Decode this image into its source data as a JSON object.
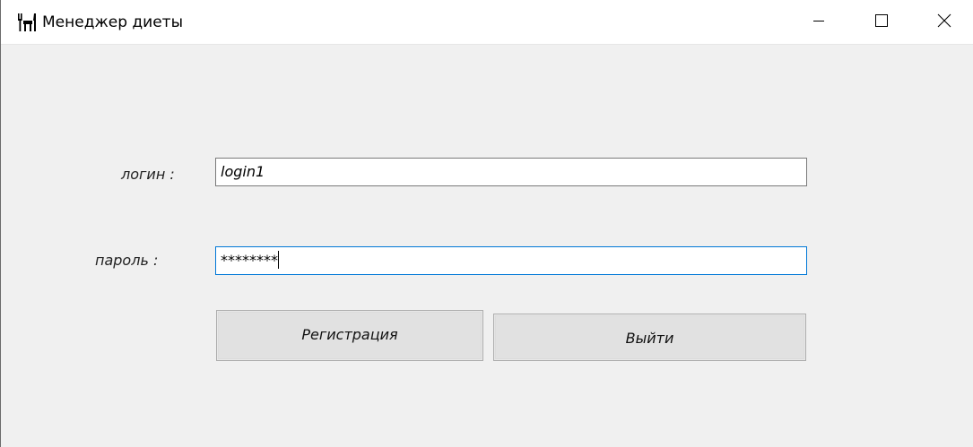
{
  "window": {
    "title": "Менеджер диеты",
    "app_icon": "fork-knife-icon",
    "controls": {
      "minimize_icon": "minimize-icon",
      "maximize_icon": "maximize-icon",
      "close_icon": "close-icon"
    }
  },
  "form": {
    "login_label": "логин :",
    "login_value": "login1",
    "password_label": "пароль :",
    "password_value": "********",
    "register_button": "Регистрация",
    "exit_button": "Выйти"
  },
  "colors": {
    "window_bg": "#f0f0f0",
    "titlebar_bg": "#ffffff",
    "focus_border": "#0078d7",
    "button_bg": "#e1e1e1"
  }
}
